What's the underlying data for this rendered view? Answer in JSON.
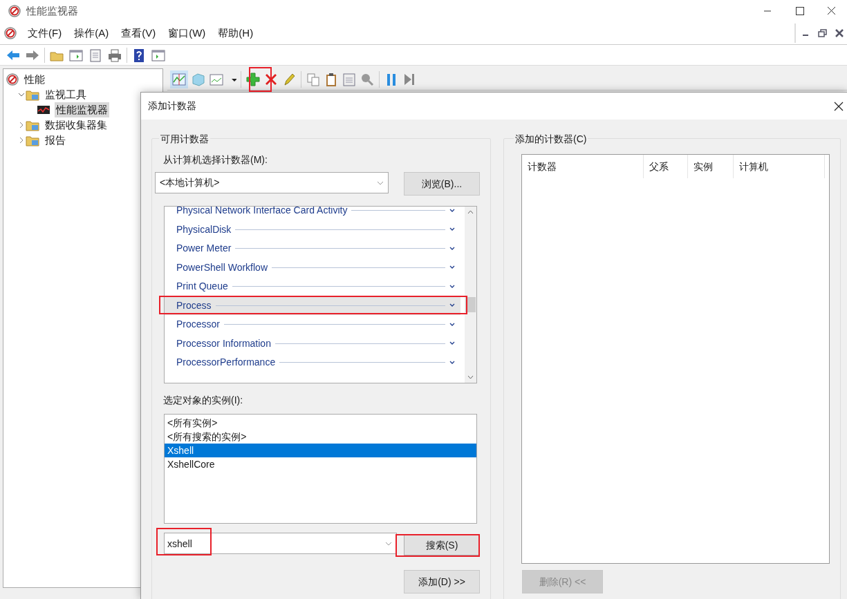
{
  "window": {
    "title": "性能监视器"
  },
  "menu": [
    "文件(F)",
    "操作(A)",
    "查看(V)",
    "窗口(W)",
    "帮助(H)"
  ],
  "tree": [
    {
      "label": "性能",
      "selected": false,
      "children": [
        {
          "label": "监视工具",
          "expanded": true,
          "selected": false,
          "children": [
            {
              "label": "性能监视器",
              "selected": true
            }
          ]
        },
        {
          "label": "数据收集器集",
          "expanded": false,
          "selected": false
        },
        {
          "label": "报告",
          "expanded": false,
          "selected": false
        }
      ]
    }
  ],
  "dialog": {
    "title": "添加计数器",
    "available": {
      "group_title": "可用计数器",
      "computer_label": "从计算机选择计数器(M):",
      "computer_value": "<本地计算机>",
      "browse_button": "浏览(B)...",
      "counters": [
        {
          "label": "Physical Network Interface Card Activity",
          "selected": false
        },
        {
          "label": "PhysicalDisk",
          "selected": false
        },
        {
          "label": "Power Meter",
          "selected": false
        },
        {
          "label": "PowerShell Workflow",
          "selected": false
        },
        {
          "label": "Print Queue",
          "selected": false
        },
        {
          "label": "Process",
          "selected": true
        },
        {
          "label": "Processor",
          "selected": false
        },
        {
          "label": "Processor Information",
          "selected": false
        },
        {
          "label": "ProcessorPerformance",
          "selected": false
        }
      ],
      "instances_label": "选定对象的实例(I):",
      "instances": [
        {
          "label": "<所有实例>",
          "selected": false
        },
        {
          "label": "<所有搜索的实例>",
          "selected": false
        },
        {
          "label": "Xshell",
          "selected": true
        },
        {
          "label": "XshellCore",
          "selected": false
        }
      ],
      "search_value": "xshell",
      "search_button": "搜索(S)",
      "add_button": "添加(D) >>"
    },
    "added": {
      "group_title": "添加的计数器(C)",
      "columns": [
        "计数器",
        "父系",
        "实例",
        "计算机"
      ],
      "remove_button": "删除(R) <<",
      "remove_disabled": true
    }
  }
}
